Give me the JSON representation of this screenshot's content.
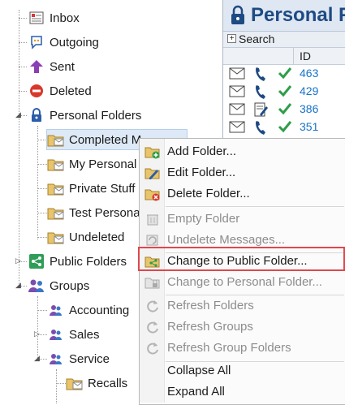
{
  "tree": {
    "items": [
      {
        "label": "Inbox",
        "icon": "inbox-icon"
      },
      {
        "label": "Outgoing",
        "icon": "outgoing-icon"
      },
      {
        "label": "Sent",
        "icon": "sent-icon"
      },
      {
        "label": "Deleted",
        "icon": "deleted-icon"
      },
      {
        "label": "Personal Folders",
        "icon": "lock-icon"
      },
      {
        "label": "Completed M",
        "icon": "folder-icon"
      },
      {
        "label": "My Personal",
        "icon": "folder-icon"
      },
      {
        "label": "Private Stuff",
        "icon": "folder-icon"
      },
      {
        "label": "Test Persona",
        "icon": "folder-icon"
      },
      {
        "label": "Undeleted",
        "icon": "folder-icon"
      },
      {
        "label": "Public Folders",
        "icon": "share-icon"
      },
      {
        "label": "Groups",
        "icon": "groups-icon"
      },
      {
        "label": "Accounting",
        "icon": "group-icon"
      },
      {
        "label": "Sales",
        "icon": "group-icon"
      },
      {
        "label": "Service",
        "icon": "group-icon"
      },
      {
        "label": "Recalls",
        "icon": "folder-icon"
      }
    ]
  },
  "right_pane": {
    "title": "Personal F",
    "search_label": "Search",
    "column_id": "ID",
    "rows": [
      {
        "id": "463"
      },
      {
        "id": "429"
      },
      {
        "id": "386"
      },
      {
        "id": "351"
      }
    ]
  },
  "context_menu": {
    "items": [
      {
        "label": "Add Folder...",
        "enabled": true
      },
      {
        "label": "Edit Folder...",
        "enabled": true
      },
      {
        "label": "Delete Folder...",
        "enabled": true
      },
      {
        "label": "Empty Folder",
        "enabled": false
      },
      {
        "label": "Undelete Messages...",
        "enabled": false
      },
      {
        "label": "Change to Public Folder...",
        "enabled": true
      },
      {
        "label": "Change to Personal Folder...",
        "enabled": false
      },
      {
        "label": "Refresh Folders",
        "enabled": false
      },
      {
        "label": "Refresh Groups",
        "enabled": false
      },
      {
        "label": "Refresh Group Folders",
        "enabled": false
      },
      {
        "label": "Collapse All",
        "enabled": true
      },
      {
        "label": "Expand All",
        "enabled": true
      }
    ]
  },
  "colors": {
    "highlight_border": "#e0474c",
    "title_blue": "#1e4a84",
    "id_blue": "#1a73c8",
    "check_green": "#2e9e4a"
  }
}
